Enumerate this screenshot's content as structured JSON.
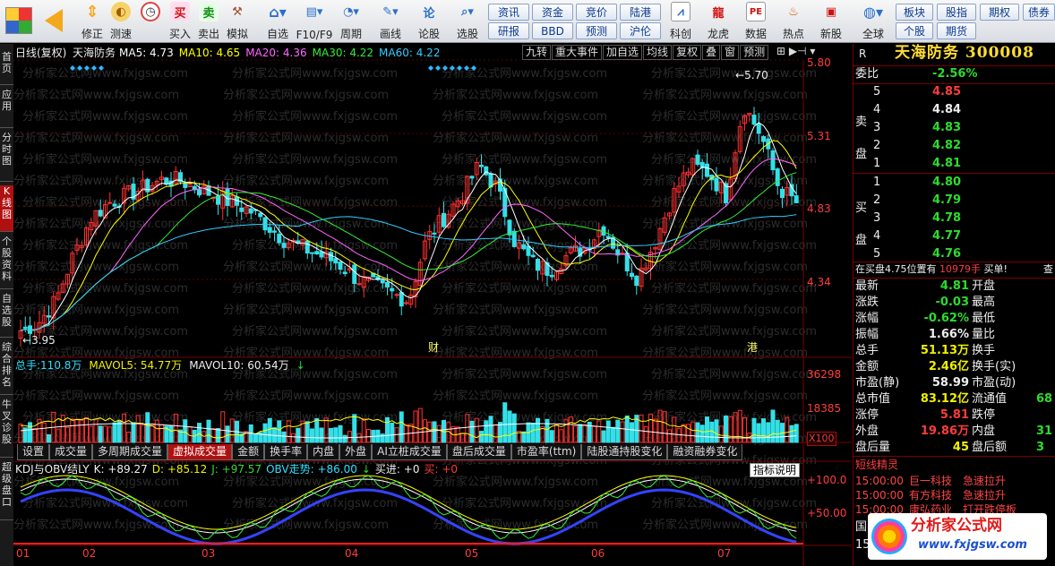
{
  "toolbar": {
    "items": [
      {
        "name": "buy",
        "label": "买入",
        "icon": "买",
        "color": "#d01010"
      },
      {
        "name": "sell",
        "label": "卖出",
        "icon": "卖",
        "color": "#109010"
      },
      {
        "name": "simulate",
        "label": "模拟",
        "icon": "hammer-icon",
        "color": "#a0522d"
      }
    ],
    "fix": "修正",
    "speed": "测速",
    "watch": "自选",
    "f10": "F10/F9",
    "period": "周期",
    "draw": "画线",
    "lunpan": "论股",
    "xuangu": "选股",
    "group1": [
      "资讯",
      "资金",
      "竞价",
      "陆港",
      "研报",
      "BBD",
      "预测",
      "沪伦"
    ],
    "kechuang": "科创",
    "longhu": "龙虎",
    "shuju": "数据",
    "redian": "热点",
    "xingu": "新股",
    "global": "全球",
    "group2": [
      "板块",
      "股指",
      "期权",
      "债券",
      "个股",
      "期货"
    ],
    "ticker": {
      "pe": "PE",
      "bbd": "BBD"
    }
  },
  "leftbar": [
    "首页",
    "应用",
    "分时图",
    "K线图",
    "个股资料",
    "自选股",
    "综合排名",
    "牛叉诊股",
    "超级盘口"
  ],
  "kline": {
    "title": "日线(复权)",
    "name": "天海防务",
    "ma": [
      {
        "label": "MA5:",
        "value": "4.73",
        "color": "#ffffff"
      },
      {
        "label": "MA10:",
        "value": "4.65",
        "color": "#ffff00"
      },
      {
        "label": "MA20:",
        "value": "4.36",
        "color": "#ff66ff"
      },
      {
        "label": "MA30:",
        "value": "4.22",
        "color": "#33ee33"
      },
      {
        "label": "MA60:",
        "value": "4.22",
        "color": "#33ccff"
      }
    ],
    "buttons": [
      "九转",
      "重大事件",
      "加自选",
      "均线",
      "复权",
      "叠",
      "窗",
      "预测"
    ],
    "prices": [
      "5.80",
      "5.31",
      "4.83",
      "4.34"
    ],
    "high": "5.70",
    "low": "3.95",
    "marks": [
      "财",
      "港"
    ]
  },
  "volume": {
    "label": "总手:",
    "value": "110.8万",
    "mavol5": "MAVOL5: 54.77万",
    "mavol10": "MAVOL10: 60.54万",
    "ticks": [
      "36298",
      "18385"
    ],
    "unit": "X100"
  },
  "tabs": [
    "设置",
    "成交量",
    "多周期成交量",
    "虚拟成交量",
    "金额",
    "换手率",
    "内盘",
    "外盘",
    "AI立桩成交量",
    "盘后成交量",
    "市盈率(ttm)",
    "陆股通持股变化",
    "融资融券变化"
  ],
  "tabs_active": 3,
  "kdj": {
    "title": "KDJ与OBV结LY",
    "k": "K: +89.27",
    "d": "D: +85.12",
    "j": "J: +97.57",
    "obv": "OBV走势: +86.00",
    "buy": "买进: +0",
    "sell": "买: +0",
    "explain": "指标说明",
    "ticks": [
      "+100.0",
      "+50.00"
    ]
  },
  "months": [
    "01",
    "02",
    "03",
    "04",
    "05",
    "06",
    "07"
  ],
  "watermark": "分析家公式网www.fxjgsw.com",
  "quote": {
    "code_letter": "R",
    "name": "天海防务",
    "code": "300008",
    "weibi_label": "委比",
    "weibi": "-2.56%",
    "sell_label": "卖盘",
    "buy_label": "买盘",
    "sell": [
      {
        "n": "5",
        "p": "4.85",
        "c": "#ff3c3c"
      },
      {
        "n": "4",
        "p": "4.84",
        "c": "#eeeeee"
      },
      {
        "n": "3",
        "p": "4.83",
        "c": "#2ddc2d"
      },
      {
        "n": "2",
        "p": "4.82",
        "c": "#2ddc2d"
      },
      {
        "n": "1",
        "p": "4.81",
        "c": "#2ddc2d"
      }
    ],
    "buy": [
      {
        "n": "1",
        "p": "4.80",
        "c": "#2ddc2d"
      },
      {
        "n": "2",
        "p": "4.79",
        "c": "#2ddc2d"
      },
      {
        "n": "3",
        "p": "4.78",
        "c": "#2ddc2d"
      },
      {
        "n": "4",
        "p": "4.77",
        "c": "#2ddc2d"
      },
      {
        "n": "5",
        "p": "4.76",
        "c": "#2ddc2d"
      }
    ],
    "notice": {
      "a": "在买盘4.75位置有",
      "b": "10979手",
      "c": "买单!",
      "d": "查"
    },
    "rows": [
      {
        "l": "最新",
        "v": "4.81",
        "c": "#2ddc2d",
        "l2": "开盘"
      },
      {
        "l": "涨跌",
        "v": "-0.03",
        "c": "#2ddc2d",
        "l2": "最高"
      },
      {
        "l": "涨幅",
        "v": "-0.62%",
        "c": "#2ddc2d",
        "l2": "最低"
      },
      {
        "l": "振幅",
        "v": "1.66%",
        "c": "#eeeeee",
        "l2": "量比"
      },
      {
        "l": "总手",
        "v": "51.13万",
        "c": "#f0f000",
        "l2": "换手"
      },
      {
        "l": "金额",
        "v": "2.46亿",
        "c": "#f0f000",
        "l2": "换手(实)"
      },
      {
        "l": "市盈(静)",
        "v": "58.99",
        "c": "#eeeeee",
        "l2": "市盈(动)"
      },
      {
        "l": "总市值",
        "v": "83.12亿",
        "c": "#f0f000",
        "l2": "流通值",
        "v2": "68"
      },
      {
        "l": "涨停",
        "v": "5.81",
        "c": "#ff3c3c",
        "l2": "跌停"
      },
      {
        "l": "外盘",
        "v": "19.86万",
        "c": "#ff3c3c",
        "l2": "内盘",
        "v2": "31"
      },
      {
        "l": "盘后量",
        "v": "45",
        "c": "#f0f000",
        "l2": "盘后额",
        "v2": "3"
      }
    ],
    "short_title": "短线精灵",
    "short": [
      {
        "t": "15:00:00",
        "s": "巨一科技",
        "e": "急速拉升"
      },
      {
        "t": "15:00:00",
        "s": "有方科技",
        "e": "急速拉升"
      },
      {
        "t": "15:00:00",
        "s": "康弘药业",
        "e": "打开跌停板"
      }
    ],
    "bottom": [
      "国",
      "15"
    ]
  },
  "logo": {
    "text": "分析家公式网",
    "url": "www.fxjgsw.com"
  }
}
